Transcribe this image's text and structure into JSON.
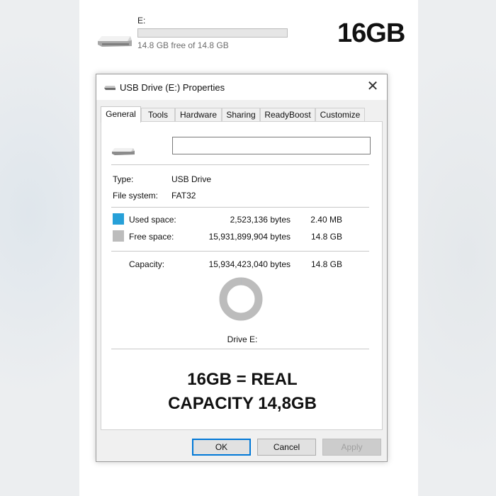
{
  "drive_tile": {
    "name": "E:",
    "free_text": "14.8 GB free of 14.8 GB",
    "size_label": "16GB",
    "usage_fraction": 0.0
  },
  "dialog": {
    "title": "USB Drive (E:) Properties",
    "close_glyph": "✕",
    "tabs": [
      "General",
      "Tools",
      "Hardware",
      "Sharing",
      "ReadyBoost",
      "Customize"
    ],
    "active_tab": "General",
    "label_value": "",
    "type_label": "Type:",
    "type_value": "USB Drive",
    "fs_label": "File system:",
    "fs_value": "FAT32",
    "used_label": "Used space:",
    "used_bytes": "2,523,136 bytes",
    "used_size": "2.40 MB",
    "free_label": "Free space:",
    "free_bytes": "15,931,899,904 bytes",
    "free_size": "14.8 GB",
    "capacity_label": "Capacity:",
    "capacity_bytes": "15,934,423,040 bytes",
    "capacity_size": "14.8 GB",
    "drive_caption": "Drive E:",
    "used_fraction": 0.00016,
    "buttons": {
      "ok": "OK",
      "cancel": "Cancel",
      "apply": "Apply"
    }
  },
  "overlay_caption": {
    "line1": "16GB  =  REAL",
    "line2": "CAPACITY  14,8GB"
  },
  "colors": {
    "used": "#27a0d8",
    "free": "#bcbcbc",
    "accent": "#0078d7"
  }
}
